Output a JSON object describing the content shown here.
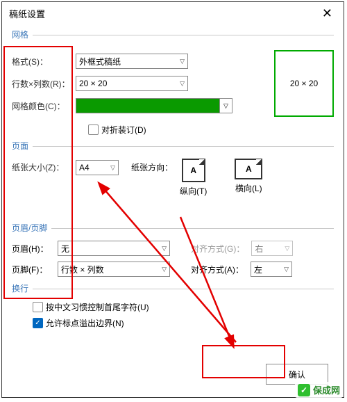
{
  "title": "稿纸设置",
  "groups": {
    "grid": "网格",
    "page": "页面",
    "hf": "页眉/页脚",
    "wrap": "换行"
  },
  "labels": {
    "format": "格式(S)：",
    "rc": "行数×列数(R)：",
    "gridcolor": "网格颜色(C)：",
    "fold": "对折装订(D)",
    "papersize": "纸张大小(Z)：",
    "paperorient": "纸张方向：",
    "portrait": "纵向(T)",
    "landscape": "横向(L)",
    "header": "页眉(H)：",
    "footer": "页脚(F)：",
    "alignG": "对齐方式(G)：",
    "alignA": "对齐方式(A)：",
    "cjk": "按中文习惯控制首尾字符(U)",
    "overflow": "允许标点溢出边界(N)"
  },
  "values": {
    "format": "外框式稿纸",
    "rc": "20 × 20",
    "papersize": "A4",
    "header": "无",
    "footer": "行数 × 列数",
    "alignG": "右",
    "alignA": "左",
    "preview": "20 × 20",
    "iconA": "A"
  },
  "buttons": {
    "ok": "确认"
  },
  "watermark": {
    "icon": "✓",
    "text": "保成网"
  }
}
